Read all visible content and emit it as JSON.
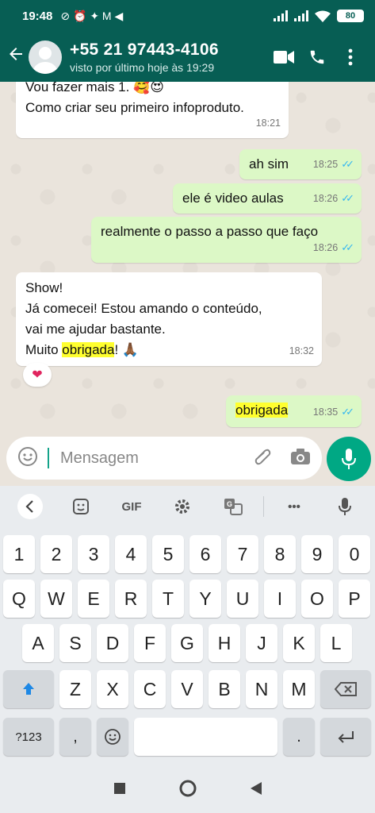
{
  "status": {
    "time": "19:48",
    "icons": "⊘ ⏰ ✦ M ◀",
    "battery": "80"
  },
  "header": {
    "name": "+55 21 97443-4106",
    "last_seen": "visto por último hoje às 19:29"
  },
  "messages": [
    {
      "lines": [
        "Vou fazer mais 1. 🥰😍",
        "Como criar seu primeiro  infoproduto."
      ],
      "time": "18:21"
    },
    {
      "text": "ah sim",
      "time": "18:25"
    },
    {
      "text": "ele é video aulas",
      "time": "18:26"
    },
    {
      "text": "realmente o passo a passo que faço",
      "time": "18:26"
    },
    {
      "lines": [
        "Show!",
        "Já comecei! Estou amando o conteúdo,",
        "vai me ajudar bastante."
      ],
      "last_pre": "Muito ",
      "last_hl": "obrigada",
      "last_post": "! 🙏🏾",
      "time": "18:32",
      "reaction": "❤"
    },
    {
      "text": "obrigada",
      "time": "18:35"
    }
  ],
  "composer": {
    "placeholder": "Mensagem"
  },
  "keyboard": {
    "toolbar": {
      "gif": "GIF",
      "more": "•••"
    },
    "row_numbers": [
      "1",
      "2",
      "3",
      "4",
      "5",
      "6",
      "7",
      "8",
      "9",
      "0"
    ],
    "row1": [
      "Q",
      "W",
      "E",
      "R",
      "T",
      "Y",
      "U",
      "I",
      "O",
      "P"
    ],
    "row2": [
      "A",
      "S",
      "D",
      "F",
      "G",
      "H",
      "J",
      "K",
      "L"
    ],
    "row3": [
      "Z",
      "X",
      "C",
      "V",
      "B",
      "N",
      "M"
    ],
    "symbols": "?123",
    "comma": ",",
    "period": "."
  }
}
